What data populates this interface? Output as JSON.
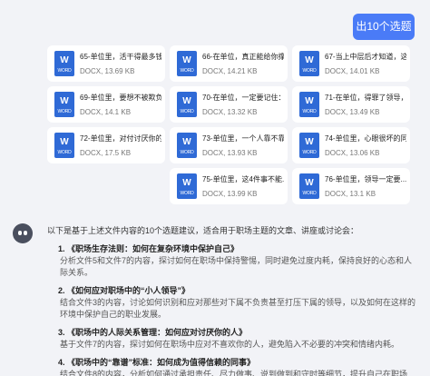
{
  "user_message": "出10个选题",
  "files": [
    {
      "icon_label": "W",
      "icon_type": "WORD",
      "name": "65-单位里，活干得最多钱...",
      "meta": "DOCX, 13.69 KB"
    },
    {
      "icon_label": "W",
      "icon_type": "WORD",
      "name": "66-在单位，真正能给你撑...",
      "meta": "DOCX, 14.21 KB"
    },
    {
      "icon_label": "W",
      "icon_type": "WORD",
      "name": "67-当上中层后才知道，这...",
      "meta": "DOCX, 14.01 KB"
    },
    {
      "icon_label": "W",
      "icon_type": "WORD",
      "name": "69-单位里，要想不被欺负...",
      "meta": "DOCX, 14.1 KB"
    },
    {
      "icon_label": "W",
      "icon_type": "WORD",
      "name": "70-在单位，一定要记住：...",
      "meta": "DOCX, 13.32 KB"
    },
    {
      "icon_label": "W",
      "icon_type": "WORD",
      "name": "71-在单位，得罪了领导，...",
      "meta": "DOCX, 13.49 KB"
    },
    {
      "icon_label": "W",
      "icon_type": "WORD",
      "name": "72-单位里，对付讨厌你的...",
      "meta": "DOCX, 17.5 KB"
    },
    {
      "icon_label": "W",
      "icon_type": "WORD",
      "name": "73-单位里，一个人靠不靠...",
      "meta": "DOCX, 13.93 KB"
    },
    {
      "icon_label": "W",
      "icon_type": "WORD",
      "name": "74-单位里，心眼很坏的同...",
      "meta": "DOCX, 13.06 KB"
    },
    {
      "icon_label": "W",
      "icon_type": "WORD",
      "name": "75-单位里，这4件事不能...",
      "meta": "DOCX, 13.99 KB"
    },
    {
      "icon_label": "W",
      "icon_type": "WORD",
      "name": "76-单位里，领导一定要...",
      "meta": "DOCX, 13.1 KB"
    }
  ],
  "answer": {
    "intro": "以下是基于上述文件内容的10个选题建议，适合用于职场主题的文章、讲座或讨论会：",
    "topics": [
      {
        "title": "1. 《职场生存法则：如何在复杂环境中保护自己》",
        "desc": "分析文件5和文件7的内容，探讨如何在职场中保持警惕，同时避免过度内耗，保持良好的心态和人际关系。"
      },
      {
        "title": "2. 《如何应对职场中的“小人领导”》",
        "desc": "结合文件3的内容，讨论如何识别和应对那些对下属不负责甚至打压下属的领导，以及如何在这样的环境中保护自己的职业发展。"
      },
      {
        "title": "3. 《职场中的人际关系管理：如何应对讨厌你的人》",
        "desc": "基于文件7的内容，探讨如何在职场中应对不喜欢你的人，避免陷入不必要的冲突和情绪内耗。"
      },
      {
        "title": "4. 《职场中的“靠谱”标准：如何成为值得信赖的同事》",
        "desc": "结合文件8的内容，分析如何通过承担责任、尽力做事、说到做到和守时等细节，提升自己在职场"
      }
    ]
  }
}
